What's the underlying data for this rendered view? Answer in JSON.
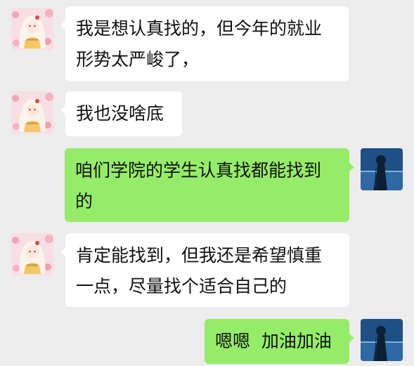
{
  "colors": {
    "background": "#ededed",
    "incoming_bubble": "#ffffff",
    "outgoing_bubble": "#95ec69"
  },
  "messages": [
    {
      "sender": "contact",
      "avatar_icon": "anime-girl-avatar-icon",
      "lines": [
        "我是想认真找的，但今年的就业",
        "形势太严峻了，"
      ]
    },
    {
      "sender": "contact",
      "avatar_icon": "anime-girl-avatar-icon",
      "lines": [
        "我也没啥底"
      ]
    },
    {
      "sender": "self",
      "avatar_icon": "silhouette-sea-avatar-icon",
      "lines": [
        "咱们学院的学生认真找都能找到",
        "的"
      ]
    },
    {
      "sender": "contact",
      "avatar_icon": "anime-girl-avatar-icon",
      "lines": [
        "肯定能找到，但我还是希望慎重",
        "一点，尽量找个适合自己的"
      ]
    },
    {
      "sender": "self",
      "avatar_icon": "silhouette-sea-avatar-icon",
      "lines": [
        "嗯嗯  加油加油"
      ]
    }
  ]
}
